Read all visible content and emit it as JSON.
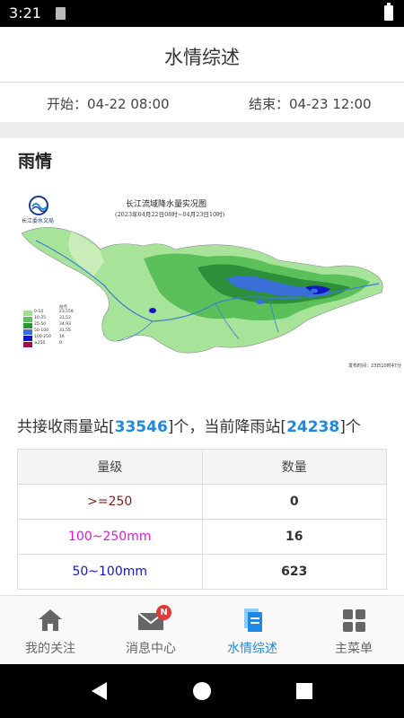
{
  "status_bar": {
    "time": "3:21"
  },
  "header": {
    "title": "水情综述"
  },
  "time_range": {
    "start": "开始：04-22 08:00",
    "end": "结束：04-23 12:00"
  },
  "rain_section": {
    "title": "雨情",
    "map": {
      "title": "长江流域降水量实况图",
      "subtitle": "(2023年04月22日08时~04月23日10时)",
      "logo_text": "长江委水文局",
      "publish_time": "发布时间：23日10时47分",
      "legend_header": "站点",
      "legend": [
        {
          "range": "0-10",
          "count": "23,559",
          "color": "#9ee08a"
        },
        {
          "range": "10-25",
          "count": "31,53",
          "color": "#5cc05a"
        },
        {
          "range": "25-50",
          "count": "34,93",
          "color": "#2c8f3a"
        },
        {
          "range": "50-100",
          "count": "31,55",
          "color": "#3a6fd8"
        },
        {
          "range": "100-250",
          "count": "16",
          "color": "#1414c8"
        },
        {
          "range": "≥250",
          "count": "0",
          "color": "#a0104a"
        }
      ]
    },
    "summary": {
      "prefix": "共接收雨量站[",
      "total_stations": "33546",
      "middle": "]个，当前降雨站[",
      "raining_stations": "24238",
      "suffix": "]个"
    },
    "table": {
      "headers": [
        "量级",
        "数量"
      ],
      "rows": [
        {
          "level": ">=250",
          "count": "0",
          "color": "#8b1a1a"
        },
        {
          "level": "100~250mm",
          "count": "16",
          "color": "#d81bd8"
        },
        {
          "level": "50~100mm",
          "count": "623",
          "color": "#1414c8"
        }
      ]
    }
  },
  "bottom_nav": {
    "items": [
      {
        "label": "我的关注",
        "icon": "home-icon"
      },
      {
        "label": "消息中心",
        "icon": "mail-icon",
        "badge": "N"
      },
      {
        "label": "水情综述",
        "icon": "document-icon"
      },
      {
        "label": "主菜单",
        "icon": "grid-icon"
      }
    ]
  },
  "colors": {
    "accent": "#1e88e5",
    "badge": "#e53935"
  }
}
